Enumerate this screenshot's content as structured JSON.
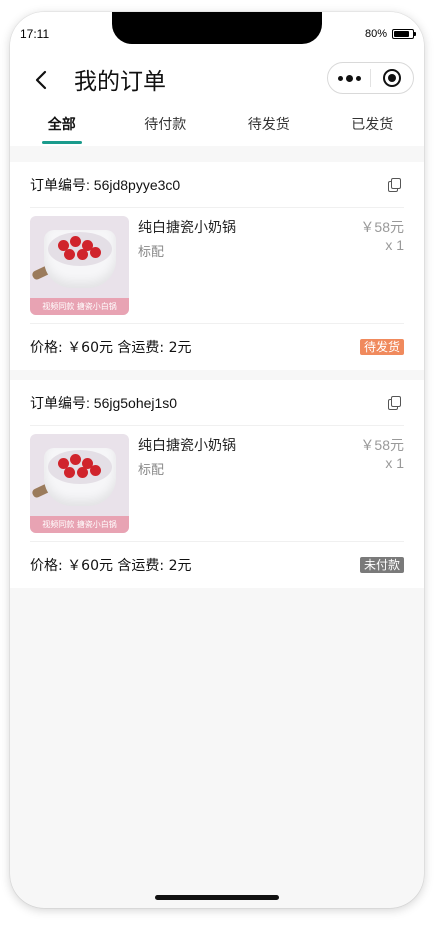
{
  "status_bar": {
    "time": "17:11",
    "battery": "80%"
  },
  "navbar": {
    "title": "我的订单"
  },
  "tabs": [
    {
      "label": "全部",
      "active": true
    },
    {
      "label": "待付款",
      "active": false
    },
    {
      "label": "待发货",
      "active": false
    },
    {
      "label": "已发货",
      "active": false
    }
  ],
  "orders": [
    {
      "order_no": "订单编号: 56jd8pyye3c0",
      "product_name": "纯白搪瓷小奶锅",
      "spec": "标配",
      "price": "￥58元",
      "qty": "x 1",
      "thumb_caption": "视频同款 搪瓷小白锅",
      "total": "价格: ￥60元 含运费: 2元",
      "status": "待发货",
      "status_color": "#f08a5d"
    },
    {
      "order_no": "订单编号: 56jg5ohej1s0",
      "product_name": "纯白搪瓷小奶锅",
      "spec": "标配",
      "price": "￥58元",
      "qty": "x 1",
      "thumb_caption": "视频同款 搪瓷小白锅",
      "total": "价格: ￥60元 含运费: 2元",
      "status": "未付款",
      "status_color": "#7a7a7a"
    }
  ],
  "colors": {
    "accent": "#1a9b8c",
    "page_bg": "#f7f7f7"
  }
}
